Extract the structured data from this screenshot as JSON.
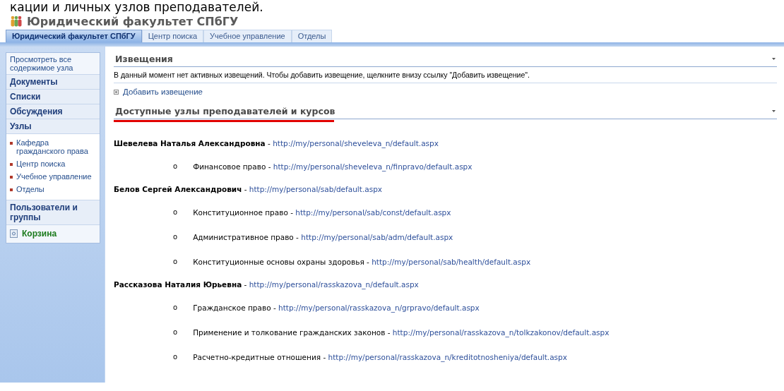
{
  "caption": "кации и личных узлов преподавателей.",
  "site": {
    "title": "Юридический факультет СПбГУ"
  },
  "tabs": [
    {
      "label": "Юридический факультет СПбГУ",
      "selected": true
    },
    {
      "label": "Центр поиска",
      "selected": false
    },
    {
      "label": "Учебное управление",
      "selected": false
    },
    {
      "label": "Отделы",
      "selected": false
    }
  ],
  "sidebar": {
    "view_all": "Просмотреть все содержимое узла",
    "sections": [
      {
        "kind": "heading",
        "label": "Документы"
      },
      {
        "kind": "heading",
        "label": "Списки"
      },
      {
        "kind": "heading",
        "label": "Обсуждения"
      },
      {
        "kind": "heading",
        "label": "Узлы",
        "children": [
          "Кафедра гражданского права",
          "Центр поиска",
          "Учебное управление",
          "Отделы"
        ]
      },
      {
        "kind": "heading",
        "label": "Пользователи и группы"
      },
      {
        "kind": "recycle",
        "label": "Корзина"
      }
    ]
  },
  "announcements": {
    "title": "Извещения",
    "message": "В данный момент нет активных извещений. Чтобы добавить извещение, щелкните внизу ссылку \"Добавить извещение\".",
    "add_link": "Добавить извещение"
  },
  "sites_list": {
    "title": "Доступные узлы преподавателей и курсов",
    "items": [
      {
        "name": "Шевелева Наталья Александровна",
        "separator": "-",
        "url": "http://my/personal/sheveleva_n/default.aspx",
        "children": [
          {
            "bullet": "o",
            "name": "Финансовое право",
            "separator": "-",
            "url": "http://my/personal/sheveleva_n/finpravo/default.aspx"
          }
        ]
      },
      {
        "name": "Белов Сергей Александрович",
        "separator": "-",
        "url": "http://my/personal/sab/default.aspx",
        "children": [
          {
            "bullet": "o",
            "name": "Конституционное право",
            "separator": "-",
            "url": "http://my/personal/sab/const/default.aspx"
          },
          {
            "bullet": "o",
            "name": "Административное право",
            "separator": "-",
            "url": "http://my/personal/sab/adm/default.aspx"
          },
          {
            "bullet": "o",
            "name": "Конституционные основы охраны здоровья",
            "separator": "-",
            "url": "http://my/personal/sab/health/default.aspx"
          }
        ]
      },
      {
        "name": "Рассказова Наталия Юрьевна",
        "separator": "-",
        "url": "http://my/personal/rasskazova_n/default.aspx",
        "children": [
          {
            "bullet": "o",
            "name": "Гражданское право",
            "separator": "-",
            "url": "http://my/personal/rasskazova_n/grpravo/default.aspx"
          },
          {
            "bullet": "o",
            "name": "Применение и толкование гражданских законов",
            "separator": "-",
            "url": "http://my/personal/rasskazova_n/tolkzakonov/default.aspx"
          },
          {
            "bullet": "o",
            "name": "Расчетно-кредитные отношения",
            "separator": "-",
            "url": "http://my/personal/rasskazova_n/kreditotnosheniya/default.aspx"
          }
        ]
      }
    ]
  }
}
